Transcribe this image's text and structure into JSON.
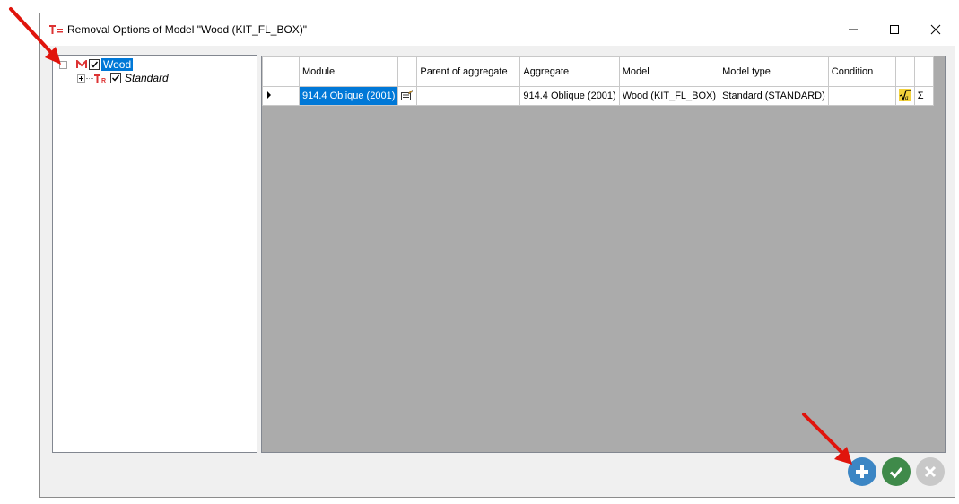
{
  "window": {
    "title": "Removal Options of Model \"Wood (KIT_FL_BOX)\"",
    "minimize_icon": "minimize-icon",
    "maximize_icon": "maximize-icon",
    "close_icon": "close-icon"
  },
  "tree": {
    "root": {
      "label": "Wood",
      "checked": true,
      "icon": "model-icon"
    },
    "child": {
      "label": "Standard",
      "checked": true,
      "icon": "model-type-icon"
    }
  },
  "grid": {
    "columns": [
      "Module",
      "",
      "Parent of aggregate",
      "Aggregate",
      "Model",
      "Model type",
      "Condition",
      "",
      ""
    ],
    "rows": [
      {
        "module": "914.4 Oblique (2001)",
        "parent_of_aggregate": "",
        "aggregate": "914.4 Oblique (2001)",
        "model": "Wood (KIT_FL_BOX)",
        "model_type": "Standard (STANDARD)",
        "condition": "",
        "sum_symbol": "Σ"
      }
    ]
  },
  "buttons": {
    "add": "add-icon",
    "confirm": "check-icon",
    "cancel": "cancel-icon"
  },
  "colors": {
    "selection": "#0078d7",
    "add_button": "#3c86c4",
    "confirm_button": "#3f8a4a",
    "cancel_button": "#c8c8c8",
    "annotation_arrow": "#e0140c"
  }
}
